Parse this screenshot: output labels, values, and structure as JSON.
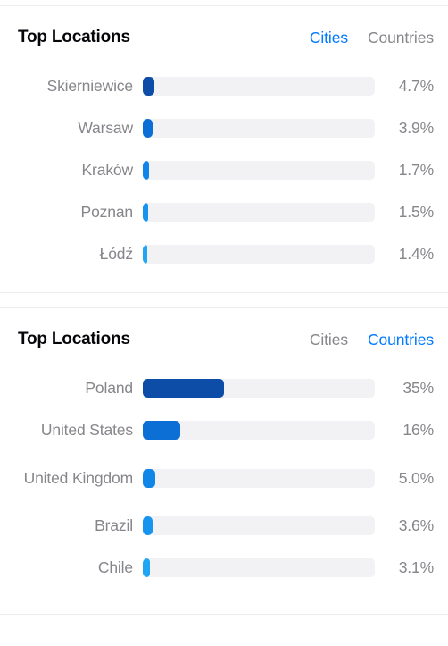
{
  "theme": {
    "background": "#ffffff",
    "card_background": "#ffffff",
    "card_border": "#ececee",
    "title_color": "#06060a",
    "muted_text": "#86868b",
    "accent": "#007aff",
    "track_color": "#f2f2f4"
  },
  "cards": [
    {
      "title": "Top Locations",
      "tabs": [
        {
          "label": "Cities",
          "active": true
        },
        {
          "label": "Countries",
          "active": false
        }
      ],
      "chart_data": {
        "type": "bar",
        "orientation": "horizontal",
        "title": "Top Locations",
        "xlabel": "",
        "ylabel": "",
        "xlim": [
          0,
          100
        ],
        "unit": "%",
        "grid": false,
        "legend": "none",
        "categories": [
          "Skierniewice",
          "Warsaw",
          "Kraków",
          "Poznan",
          "Łódź"
        ],
        "values": [
          4.7,
          3.9,
          1.7,
          1.5,
          1.4
        ],
        "value_labels": [
          "4.7%",
          "3.9%",
          "1.7%",
          "1.5%",
          "1.4%"
        ],
        "bar_colors": [
          "#0d4da8",
          "#0b6fd6",
          "#0f86e8",
          "#1694ee",
          "#20a5f2"
        ]
      },
      "rows": [
        {
          "label": "Skierniewice",
          "value_label": "4.7%",
          "percent": 4.7,
          "color": "#0d4da8",
          "bar_width_pct": 5.1
        },
        {
          "label": "Warsaw",
          "value_label": "3.9%",
          "percent": 3.9,
          "color": "#0b6fd6",
          "bar_width_pct": 4.4
        },
        {
          "label": "Kraków",
          "value_label": "1.7%",
          "percent": 1.7,
          "color": "#0f86e8",
          "bar_width_pct": 2.6
        },
        {
          "label": "Poznan",
          "value_label": "1.5%",
          "percent": 1.5,
          "color": "#1694ee",
          "bar_width_pct": 2.4
        },
        {
          "label": "Łódź",
          "value_label": "1.4%",
          "percent": 1.4,
          "color": "#20a5f2",
          "bar_width_pct": 1.8
        }
      ]
    },
    {
      "title": "Top Locations",
      "tabs": [
        {
          "label": "Cities",
          "active": false
        },
        {
          "label": "Countries",
          "active": true
        }
      ],
      "chart_data": {
        "type": "bar",
        "orientation": "horizontal",
        "title": "Top Locations",
        "xlabel": "",
        "ylabel": "",
        "xlim": [
          0,
          100
        ],
        "unit": "%",
        "grid": false,
        "legend": "none",
        "categories": [
          "Poland",
          "United States",
          "United Kingdom",
          "Brazil",
          "Chile"
        ],
        "values": [
          35,
          16,
          5.0,
          3.6,
          3.1
        ],
        "value_labels": [
          "35%",
          "16%",
          "5.0%",
          "3.6%",
          "3.1%"
        ],
        "bar_colors": [
          "#0d4da8",
          "#0b6fd6",
          "#0f86e8",
          "#1694ee",
          "#20a5f2"
        ]
      },
      "rows": [
        {
          "label": "Poland",
          "value_label": "35%",
          "percent": 35,
          "color": "#0d4da8",
          "bar_width_pct": 35
        },
        {
          "label": "United States",
          "value_label": "16%",
          "percent": 16,
          "color": "#0b6fd6",
          "bar_width_pct": 16
        },
        {
          "label": "United Kingdom",
          "value_label": "5.0%",
          "percent": 5.0,
          "color": "#0f86e8",
          "bar_width_pct": 5.4
        },
        {
          "label": "Brazil",
          "value_label": "3.6%",
          "percent": 3.6,
          "color": "#1694ee",
          "bar_width_pct": 4.4
        },
        {
          "label": "Chile",
          "value_label": "3.1%",
          "percent": 3.1,
          "color": "#20a5f2",
          "bar_width_pct": 3.2
        }
      ]
    }
  ]
}
